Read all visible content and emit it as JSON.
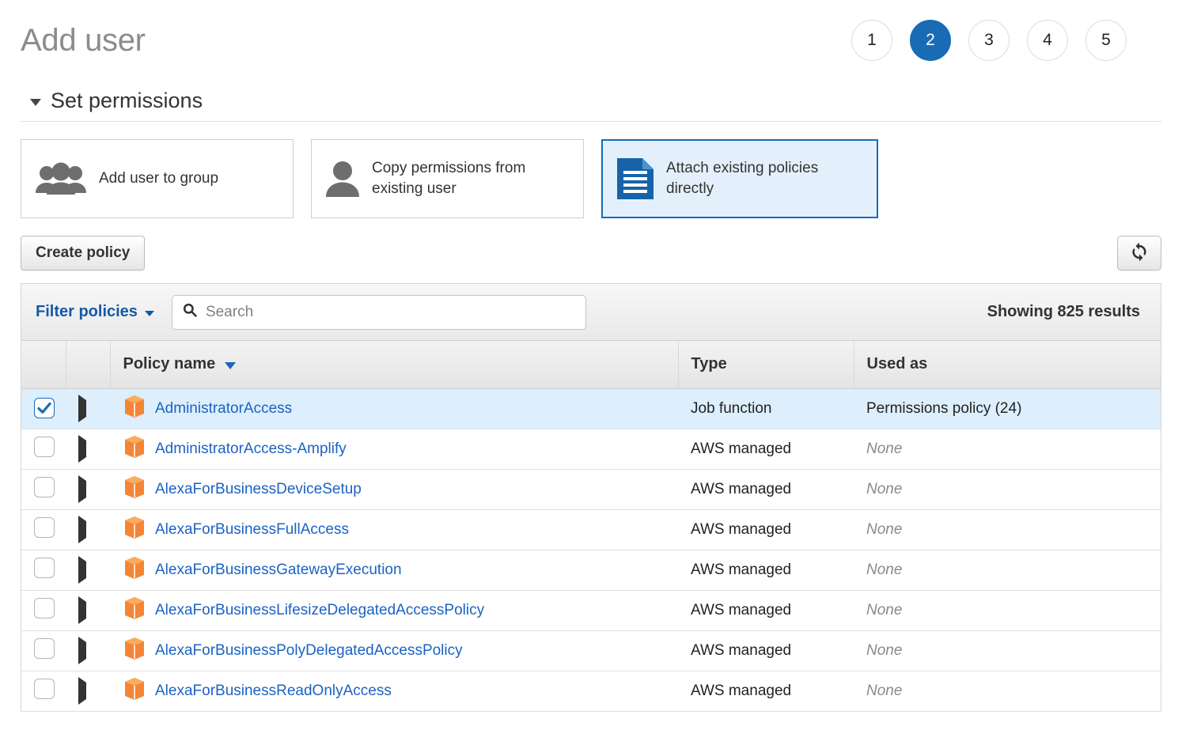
{
  "header": {
    "title": "Add user",
    "steps": [
      {
        "label": "1",
        "active": false
      },
      {
        "label": "2",
        "active": true
      },
      {
        "label": "3",
        "active": false
      },
      {
        "label": "4",
        "active": false
      },
      {
        "label": "5",
        "active": false
      }
    ]
  },
  "permissions": {
    "section_title": "Set permissions",
    "options": [
      {
        "label": "Add user to group",
        "icon": "users-group-icon",
        "selected": false
      },
      {
        "label": "Copy permissions from existing user",
        "icon": "user-icon",
        "selected": false
      },
      {
        "label": "Attach existing policies directly",
        "icon": "document-lines-icon",
        "selected": true
      }
    ]
  },
  "actions": {
    "create_policy_label": "Create policy",
    "refresh_icon": "refresh-icon"
  },
  "filter": {
    "filter_link_label": "Filter policies",
    "search_placeholder": "Search",
    "search_value": "",
    "results_text": "Showing 825 results"
  },
  "table": {
    "columns": {
      "policy_name": "Policy name",
      "type": "Type",
      "used_as": "Used as"
    },
    "sort_column": "Policy name",
    "rows": [
      {
        "checked": true,
        "name": "AdministratorAccess",
        "type": "Job function",
        "used_as": "Permissions policy (24)",
        "used_as_none": false
      },
      {
        "checked": false,
        "name": "AdministratorAccess-Amplify",
        "type": "AWS managed",
        "used_as": "None",
        "used_as_none": true
      },
      {
        "checked": false,
        "name": "AlexaForBusinessDeviceSetup",
        "type": "AWS managed",
        "used_as": "None",
        "used_as_none": true
      },
      {
        "checked": false,
        "name": "AlexaForBusinessFullAccess",
        "type": "AWS managed",
        "used_as": "None",
        "used_as_none": true
      },
      {
        "checked": false,
        "name": "AlexaForBusinessGatewayExecution",
        "type": "AWS managed",
        "used_as": "None",
        "used_as_none": true
      },
      {
        "checked": false,
        "name": "AlexaForBusinessLifesizeDelegatedAccessPolicy",
        "type": "AWS managed",
        "used_as": "None",
        "used_as_none": true
      },
      {
        "checked": false,
        "name": "AlexaForBusinessPolyDelegatedAccessPolicy",
        "type": "AWS managed",
        "used_as": "None",
        "used_as_none": true
      },
      {
        "checked": false,
        "name": "AlexaForBusinessReadOnlyAccess",
        "type": "AWS managed",
        "used_as": "None",
        "used_as_none": true
      }
    ]
  },
  "colors": {
    "accent_blue": "#1a6bb5",
    "link_blue": "#1b62c4",
    "policy_icon_orange": "#f58536",
    "selected_row_bg": "#ddeefc",
    "selected_card_bg": "#e3f0fb",
    "title_gray": "#8c8c8c"
  }
}
